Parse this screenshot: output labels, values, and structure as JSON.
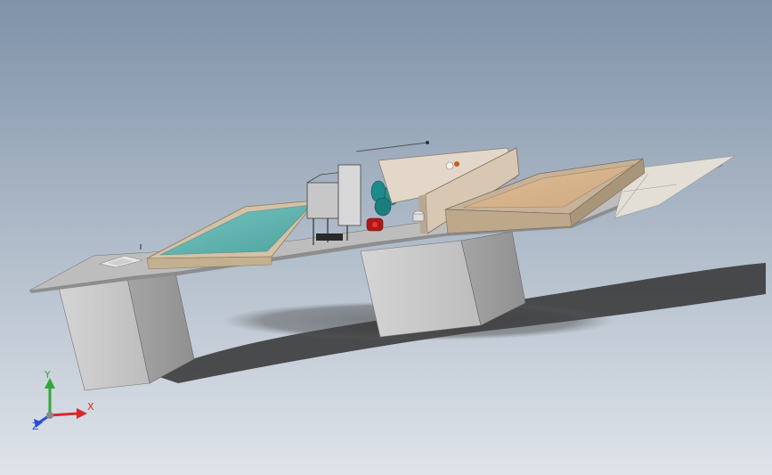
{
  "viewport": {
    "background_top": "#7f92a8",
    "background_bottom": "#dfe4ea"
  },
  "triad": {
    "x_label": "X",
    "y_label": "Y",
    "z_label": "Z",
    "x_color": "#d62a2a",
    "y_color": "#2fa83a",
    "z_color": "#2a4fd6"
  },
  "model": {
    "platform_color": "#b9b9b9",
    "pool_water_color": "#5fb3b0",
    "pool_rim_color": "#d8c7ac",
    "sand_bed_color": "#d6b48e",
    "tank_color": "#1f8a8a",
    "pump_color": "#b01818"
  }
}
